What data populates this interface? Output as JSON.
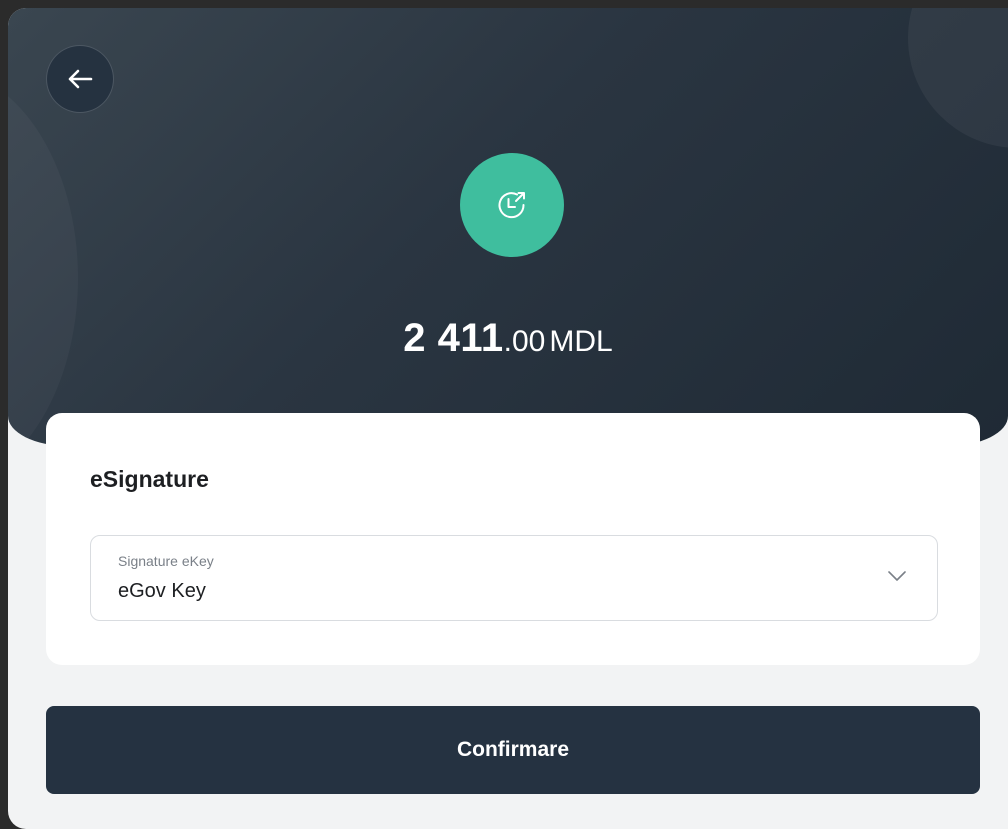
{
  "header": {
    "back_icon": "arrow-left-icon",
    "status_icon": "clock-outgoing-icon",
    "status_color": "#3fbe9e"
  },
  "amount": {
    "integer": "2 411",
    "decimal": ".00",
    "currency": "MDL"
  },
  "card": {
    "title": "eSignature",
    "select": {
      "label": "Signature eKey",
      "value": "eGov Key",
      "icon": "chevron-down-icon"
    }
  },
  "actions": {
    "confirm_label": "Confirmare",
    "confirm_color": "#253241"
  }
}
